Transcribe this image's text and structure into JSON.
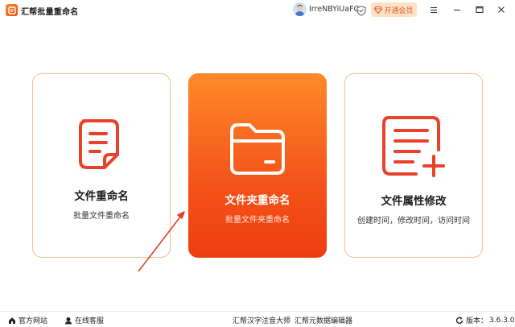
{
  "app": {
    "title": "汇帮批量重命名"
  },
  "user": {
    "name": "IrreNBYiUaFC"
  },
  "header": {
    "vip_label": "开通会员"
  },
  "cards": [
    {
      "title": "文件重命名",
      "subtitle": "批量文件重命名"
    },
    {
      "title": "文件夹重命名",
      "subtitle": "批量文件夹重命名"
    },
    {
      "title": "文件属性修改",
      "subtitle": "创建时间，修改时间，访问时间"
    }
  ],
  "footer": {
    "website": "官方网站",
    "support": "在线客服",
    "pinyin_tool": "汇帮汉字注音大师",
    "metadata_tool": "汇帮元数据编辑器",
    "version_label": "版本：",
    "version": "3.6.3.0"
  },
  "colors": {
    "accent": "#f4531a",
    "accent_light": "#ff8a2a",
    "card_border": "#f4c08a",
    "icon_red": "#e8432a",
    "vip_bg": "#fde3c6"
  }
}
